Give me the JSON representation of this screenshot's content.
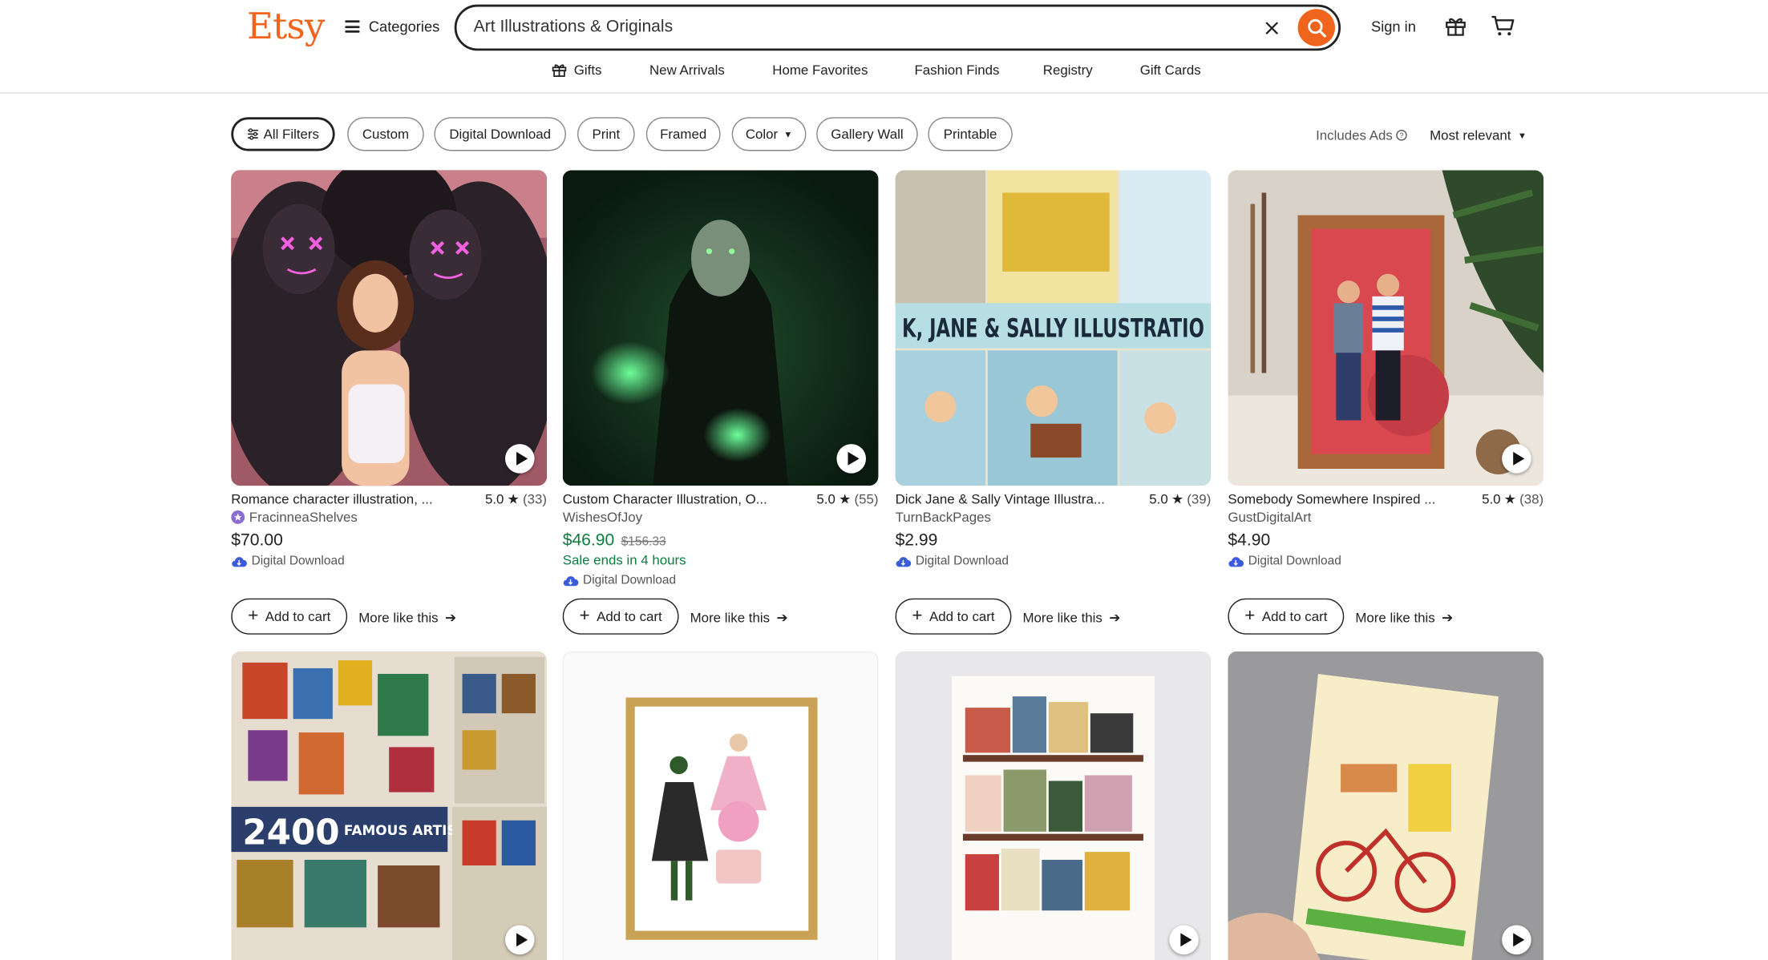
{
  "header": {
    "logo": "Etsy",
    "categories_label": "Categories",
    "search_value": "Art Illustrations & Originals",
    "signin_label": "Sign in",
    "icons": [
      "menu-icon",
      "close-icon",
      "search-icon",
      "gift-icon",
      "cart-icon"
    ],
    "accent_color": "#f1641e"
  },
  "subnav": [
    "Gifts",
    "New Arrivals",
    "Home Favorites",
    "Fashion Finds",
    "Registry",
    "Gift Cards"
  ],
  "filters": {
    "all_filters": "All Filters",
    "chips": [
      "Custom",
      "Digital Download",
      "Print",
      "Framed",
      "Color",
      "Gallery Wall",
      "Printable"
    ],
    "includes_ads": "Includes Ads",
    "sort": "Most relevant"
  },
  "listings": [
    {
      "title": "Romance character illustration, ...",
      "rating": "5.0",
      "reviews": "(33)",
      "shop": "FracinneaShelves",
      "price": "$70.00",
      "format": "Digital Download",
      "add_to_cart": "Add to cart",
      "more_like_this": "More like this"
    },
    {
      "title": "Custom Character Illustration, O...",
      "rating": "5.0",
      "reviews": "(55)",
      "shop": "WishesOfJoy",
      "price": "$46.90",
      "original_price": "$156.33",
      "sale_text": "Sale ends in 4 hours",
      "format": "Digital Download",
      "add_to_cart": "Add to cart",
      "more_like_this": "More like this"
    },
    {
      "title": "Dick Jane & Sally Vintage Illustra...",
      "rating": "5.0",
      "reviews": "(39)",
      "shop": "TurnBackPages",
      "price": "$2.99",
      "format": "Digital Download",
      "add_to_cart": "Add to cart",
      "more_like_this": "More like this",
      "image_text": "K, JANE & SALLY ILLUSTRATIO"
    },
    {
      "title": "Somebody Somewhere Inspired ...",
      "rating": "5.0",
      "reviews": "(38)",
      "shop": "GustDigitalArt",
      "price": "$4.90",
      "format": "Digital Download",
      "add_to_cart": "Add to cart",
      "more_like_this": "More like this"
    }
  ],
  "second_row": [
    {
      "image_text_big": "2400",
      "image_text_small": "FAMOUS ARTISTS"
    },
    {},
    {},
    {}
  ]
}
